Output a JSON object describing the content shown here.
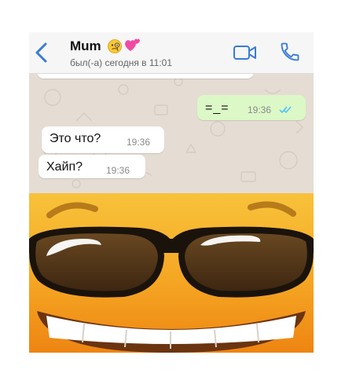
{
  "header": {
    "contact_name": "Mum",
    "name_emojis": [
      "face-with-monocle",
      "two-hearts"
    ],
    "last_seen": "был(-а) сегодня в 11:01",
    "accent_color": "#3a7bd5"
  },
  "messages": [
    {
      "direction": "out",
      "text": "=_=",
      "time": "19:36",
      "status": "read"
    },
    {
      "direction": "in",
      "text": "Это что?",
      "time": "19:36"
    },
    {
      "direction": "in",
      "text": "Хайп?",
      "time": "19:36"
    }
  ],
  "colors": {
    "chat_background": "#e5ddd3",
    "outgoing_bubble": "#dcf8c6",
    "incoming_bubble": "#ffffff",
    "read_ticks": "#4fc3f7",
    "emoji_skin_top": "#f4b42a",
    "emoji_skin_bottom": "#f08a14"
  },
  "meme": {
    "icon": "grinning-face-with-sunglasses"
  }
}
